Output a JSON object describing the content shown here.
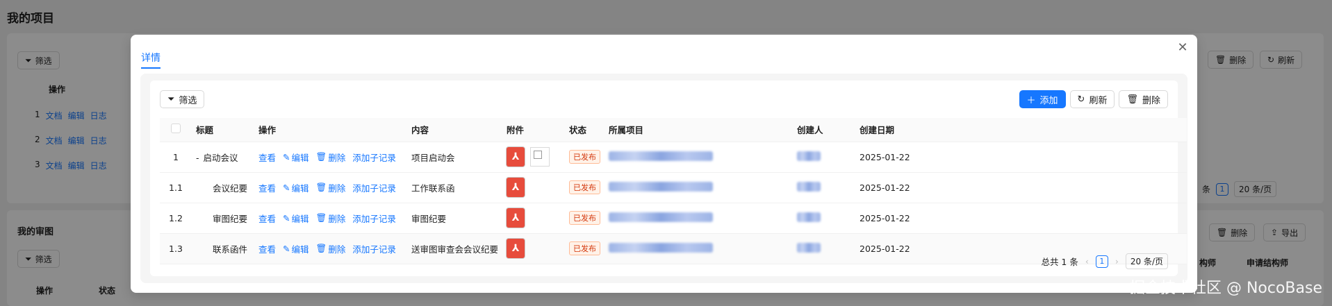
{
  "background": {
    "page_title": "我的项目",
    "filter_label": "筛选",
    "ops_header": "操作",
    "rows": [
      {
        "index": "1",
        "doc": "文档",
        "edit": "编辑",
        "log": "日志"
      },
      {
        "index": "2",
        "doc": "文档",
        "edit": "编辑",
        "log": "日志"
      },
      {
        "index": "3",
        "doc": "文档",
        "edit": "编辑",
        "log": "日志"
      }
    ],
    "delete_label": "删除",
    "refresh_label": "刷新",
    "pager_page": "1",
    "pager_size": "20 条/页",
    "pager_tail": "条",
    "section2_title": "我的审图",
    "section2_filter": "筛选",
    "section2_delete": "删除",
    "section2_export": "导出",
    "section2_col_ops": "操作",
    "section2_col_status": "状态",
    "section2_col_a": "构师",
    "section2_col_b": "申请结构师"
  },
  "modal": {
    "tab_label": "详情",
    "filter_label": "筛选",
    "add_label": "添加",
    "refresh_label": "刷新",
    "delete_label": "删除",
    "columns": {
      "title": "标题",
      "actions": "操作",
      "content": "内容",
      "attachment": "附件",
      "status": "状态",
      "project": "所属项目",
      "creator": "创建人",
      "created": "创建日期"
    },
    "action_labels": {
      "view": "查看",
      "edit": "编辑",
      "delete": "删除",
      "add_child": "添加子记录"
    },
    "rows": [
      {
        "index": "1",
        "title": "启动会议",
        "content": "项目启动会",
        "status": "已发布",
        "date": "2025-01-22",
        "expand": "-",
        "has_image": true
      },
      {
        "index": "1.1",
        "title": "会议纪要",
        "content": "工作联系函",
        "status": "已发布",
        "date": "2025-01-22",
        "expand": "",
        "has_image": false
      },
      {
        "index": "1.2",
        "title": "审图纪要",
        "content": "审图纪要",
        "status": "已发布",
        "date": "2025-01-22",
        "expand": "",
        "has_image": false
      },
      {
        "index": "1.3",
        "title": "联系函件",
        "content": "送审图审查会会议纪要",
        "status": "已发布",
        "date": "2025-01-22",
        "expand": "",
        "has_image": false
      }
    ],
    "pager": {
      "total": "总共 1 条",
      "page": "1",
      "size": "20 条/页"
    }
  },
  "watermark": "掘金技术社区 @ NocoBase"
}
